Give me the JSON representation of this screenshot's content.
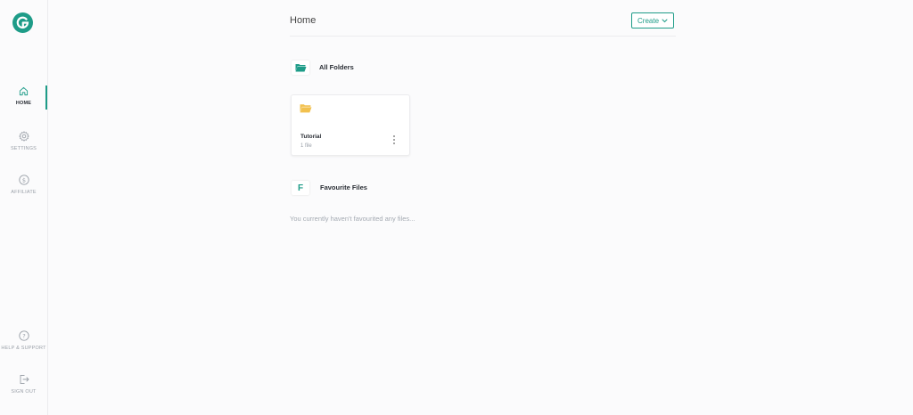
{
  "sidebar": {
    "items": [
      {
        "label": "HOME",
        "icon": "home-icon",
        "active": true
      },
      {
        "label": "SETTINGS",
        "icon": "gear-icon",
        "active": false
      },
      {
        "label": "AFFILIATE",
        "icon": "dollar-circle-icon",
        "active": false
      },
      {
        "label": "HELP & SUPPORT",
        "icon": "question-circle-icon",
        "active": false
      },
      {
        "label": "SIGN OUT",
        "icon": "sign-out-icon",
        "active": false
      }
    ]
  },
  "header": {
    "title": "Home",
    "create_label": "Create"
  },
  "folders_section": {
    "title": "All Folders",
    "folders": [
      {
        "name": "Tutorial",
        "count": "1 file"
      }
    ]
  },
  "favourites_section": {
    "icon_letter": "F",
    "title": "Favourite Files",
    "empty_message": "You currently haven't favourited any files..."
  },
  "colors": {
    "accent": "#1e9c88",
    "folder": "#f2c14e",
    "muted": "#9aa0a8"
  }
}
